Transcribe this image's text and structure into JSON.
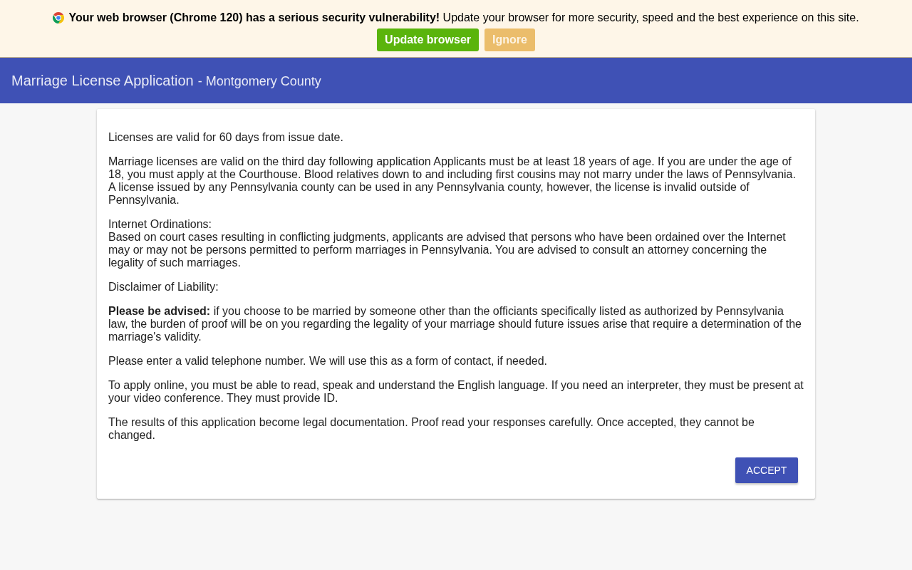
{
  "update_banner": {
    "message": "**Your web browser (Chrome 120) has a serious security vulnerability!** Update your browser for more security, speed and the best experience on this site.",
    "buttons": [
      {
        "label": "Update browser",
        "kind": "primary"
      },
      {
        "label": "Ignore",
        "kind": "secondary"
      }
    ]
  },
  "header": {
    "title": "Marriage License Application",
    "subtitle": "- Montgomery County"
  },
  "notice": {
    "paragraphs": [
      {
        "text": "Licenses are valid for 60 days from issue date."
      },
      {
        "text": "Marriage licenses are valid on the third day following application Applicants must be at least 18 years of age. If you are under the age of 18, you must apply at the Courthouse. Blood relatives down to and including first cousins may not marry under the laws of Pennsylvania. A license issued by any Pennsylvania county can be used in any Pennsylvania county, however, the license is invalid outside of Pennsylvania."
      },
      {
        "heading": "Internet Ordinations:",
        "text": "Based on court cases resulting in conflicting judgments, applicants are advised that persons who have been ordained over the Internet may or may not be persons permitted to perform marriages in Pennsylvania. You are advised to consult an attorney concerning the legality of such marriages."
      },
      {
        "text": "Disclaimer of Liability:"
      },
      {
        "text": "**Please be advised:** if you choose to be married by someone other than the officiants specifically listed as authorized by Pennsylvania law, the burden of proof will be on you regarding the legality of your marriage should future issues arise that require a determination of the marriage's validity."
      },
      {
        "text": "Please enter a valid telephone number. We will use this as a form of contact, if needed."
      },
      {
        "text": "To apply online, you must be able to read, speak and understand the English language. If you need an interpreter, they must be present at your video conference. They must provide ID."
      },
      {
        "text": "The results of this application become legal documentation. Proof read your responses carefully. Once accepted, they cannot be changed."
      }
    ],
    "button": {
      "label": "ACCEPT"
    }
  }
}
